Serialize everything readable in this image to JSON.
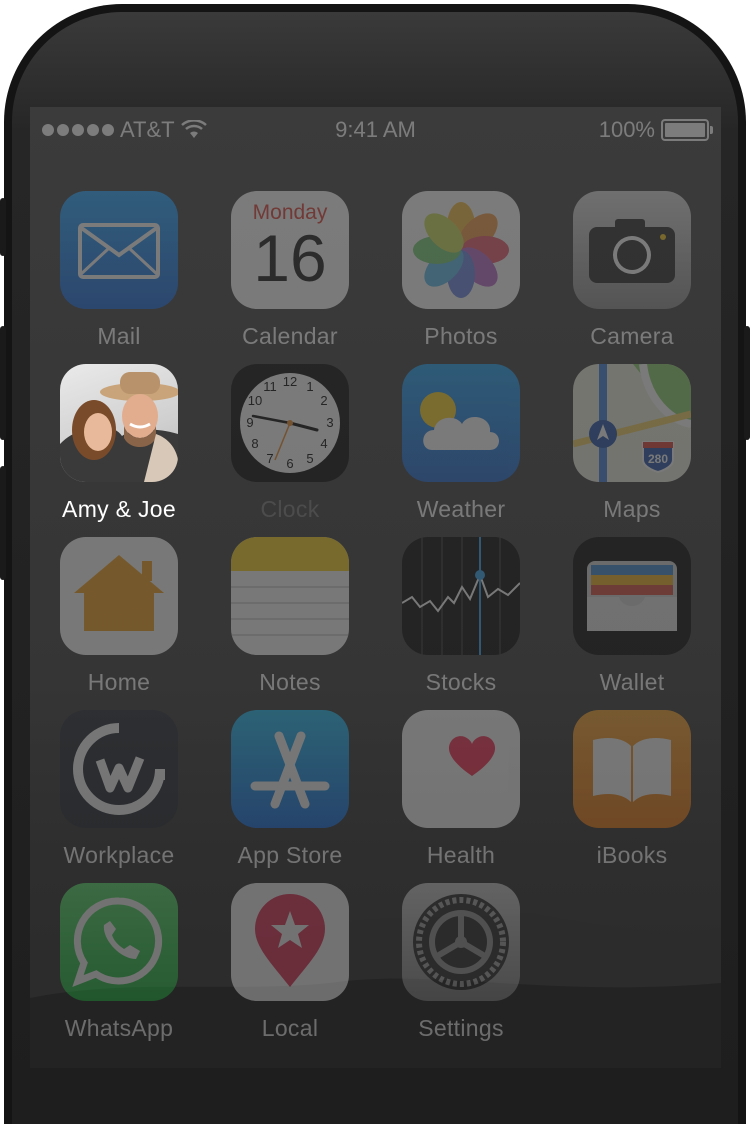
{
  "status_bar": {
    "carrier": "AT&T",
    "time": "9:41 AM",
    "battery_percent": "100%",
    "battery_level": 1.0,
    "signal_bars": 5,
    "icons": [
      "signal-dots-icon",
      "wifi-icon",
      "battery-icon"
    ]
  },
  "calendar_icon": {
    "weekday": "Monday",
    "day": "16"
  },
  "maps_icon": {
    "route_number": "280"
  },
  "apps": [
    {
      "label": "Mail",
      "icon": "mail-icon",
      "color": "#1a80e6"
    },
    {
      "label": "Calendar",
      "icon": "calendar-icon",
      "color": "#ffffff"
    },
    {
      "label": "Photos",
      "icon": "photos-icon",
      "color": "#ffffff"
    },
    {
      "label": "Camera",
      "icon": "camera-icon",
      "color": "#8a8a8a"
    },
    {
      "label": "Amy & Joe",
      "icon": "contact-photo-icon",
      "highlighted": true
    },
    {
      "label": "Clock",
      "icon": "clock-icon",
      "color": "#000000"
    },
    {
      "label": "Weather",
      "icon": "weather-icon",
      "color": "#1e8ee8"
    },
    {
      "label": "Maps",
      "icon": "maps-icon",
      "color": "#e8f0d8"
    },
    {
      "label": "Home",
      "icon": "home-icon",
      "color": "#ffffff"
    },
    {
      "label": "Notes",
      "icon": "notes-icon",
      "color": "#ffffff"
    },
    {
      "label": "Stocks",
      "icon": "stocks-icon",
      "color": "#000000"
    },
    {
      "label": "Wallet",
      "icon": "wallet-icon",
      "color": "#000000"
    },
    {
      "label": "Workplace",
      "icon": "workplace-icon",
      "color": "#20252e"
    },
    {
      "label": "App Store",
      "icon": "app-store-icon",
      "color": "#1a9af0"
    },
    {
      "label": "Health",
      "icon": "health-icon",
      "color": "#ffffff"
    },
    {
      "label": "iBooks",
      "icon": "ibooks-icon",
      "color": "#f7931e"
    },
    {
      "label": "WhatsApp",
      "icon": "whatsapp-icon",
      "color": "#2ad24d"
    },
    {
      "label": "Local",
      "icon": "local-icon",
      "color": "#ffffff"
    },
    {
      "label": "Settings",
      "icon": "settings-icon",
      "color": "#9a9a9a"
    }
  ]
}
